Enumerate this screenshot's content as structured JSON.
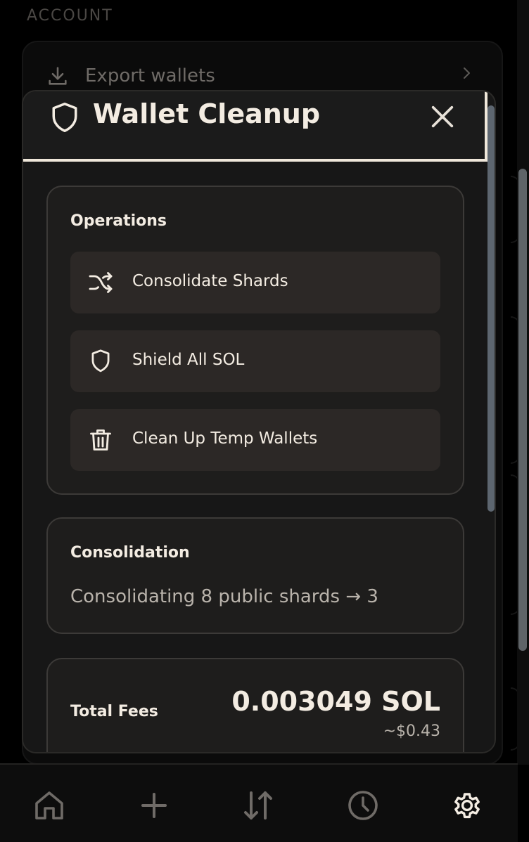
{
  "background": {
    "section_label": "ACCOUNT",
    "export_row_label": "Export wallets",
    "export_icon": "download-icon",
    "chevron_icon": "chevron-right-icon"
  },
  "modal": {
    "title": "Wallet Cleanup",
    "header_icon": "shield-icon",
    "close_icon": "close-icon",
    "operations": {
      "title": "Operations",
      "items": [
        {
          "label": "Consolidate Shards",
          "icon": "shuffle-icon"
        },
        {
          "label": "Shield All SOL",
          "icon": "shield-icon"
        },
        {
          "label": "Clean Up Temp Wallets",
          "icon": "trash-icon"
        }
      ]
    },
    "consolidation": {
      "title": "Consolidation",
      "text": "Consolidating 8 public shards → 3"
    },
    "fees": {
      "label": "Total Fees",
      "amount": "0.003049 SOL",
      "usd": "~$0.43"
    }
  },
  "bottom_nav": {
    "items": [
      {
        "icon": "home-icon",
        "active": false
      },
      {
        "icon": "plus-icon",
        "active": false
      },
      {
        "icon": "transfer-arrows-icon",
        "active": false
      },
      {
        "icon": "clock-icon",
        "active": false
      },
      {
        "icon": "gear-icon",
        "active": true
      }
    ]
  },
  "colors": {
    "accent": "#f3ece2",
    "background": "#000000",
    "surface": "#1e1d1c",
    "button": "#2c2826",
    "muted_text": "#b9b3ab"
  }
}
